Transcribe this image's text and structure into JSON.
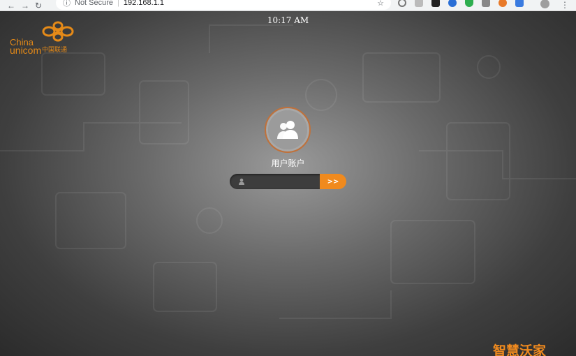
{
  "browser": {
    "security_label": "Not Secure",
    "url": "192.168.1.1"
  },
  "header": {
    "time": "10:17 AM"
  },
  "logo": {
    "line1": "China",
    "line2": "unicom",
    "cn": "中国联通"
  },
  "login": {
    "account_label": "用户账户",
    "input_value": "",
    "input_placeholder": "",
    "submit_label": ">>"
  },
  "footer": {
    "brand": "智慧沃家"
  },
  "colors": {
    "accent": "#f08a1e",
    "logo": "#e58a18"
  }
}
